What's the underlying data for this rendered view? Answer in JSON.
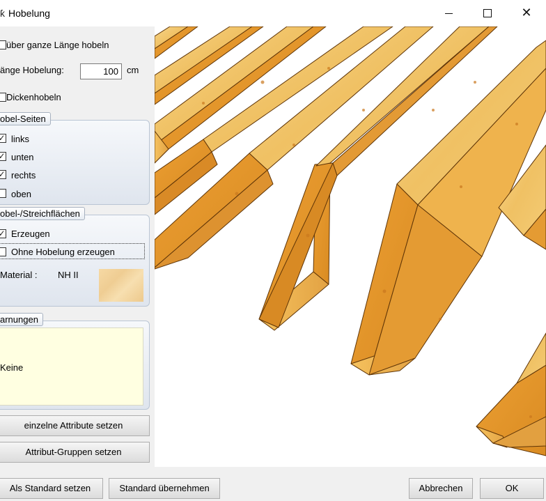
{
  "window": {
    "title": "Hobelung",
    "minimize_glyph": "minimize",
    "maximize_glyph": "maximize",
    "close_glyph": "✕"
  },
  "options": {
    "full_length": {
      "label": "über ganze Länge hobeln",
      "checked": false
    },
    "length": {
      "label": "änge Hobelung:",
      "value": "100",
      "unit": "cm"
    },
    "thickness": {
      "label": "Dickenhobeln",
      "checked": false
    }
  },
  "sides_group": {
    "title": "obel-Seiten",
    "items": [
      {
        "label": "links",
        "checked": true
      },
      {
        "label": "unten",
        "checked": true
      },
      {
        "label": "rechts",
        "checked": true
      },
      {
        "label": "oben",
        "checked": false
      }
    ]
  },
  "surfaces_group": {
    "title": "obel-/Streichflächen",
    "create": {
      "label": "Erzeugen",
      "checked": true
    },
    "without": {
      "label": "Ohne Hobelung erzeugen",
      "checked": false
    },
    "material_label": "Material :",
    "material_value": "NH II",
    "material_color": "#f2d29a"
  },
  "warnings_group": {
    "title": "arnungen",
    "text": "Keine",
    "background": "#ffffe1"
  },
  "buttons": {
    "single_attributes": "einzelne Attribute setzen",
    "attribute_groups": "Attribut-Gruppen setzen",
    "set_default": "Als Standard setzen",
    "apply_default": "Standard übernehmen",
    "cancel": "Abbrechen",
    "ok": "OK"
  },
  "colors": {
    "wood_light": "#f2c26a",
    "wood_mid": "#e7a53e",
    "wood_dark": "#b97016",
    "wood_edge": "#6a3a08",
    "viewport_bg": "#ffffff"
  }
}
